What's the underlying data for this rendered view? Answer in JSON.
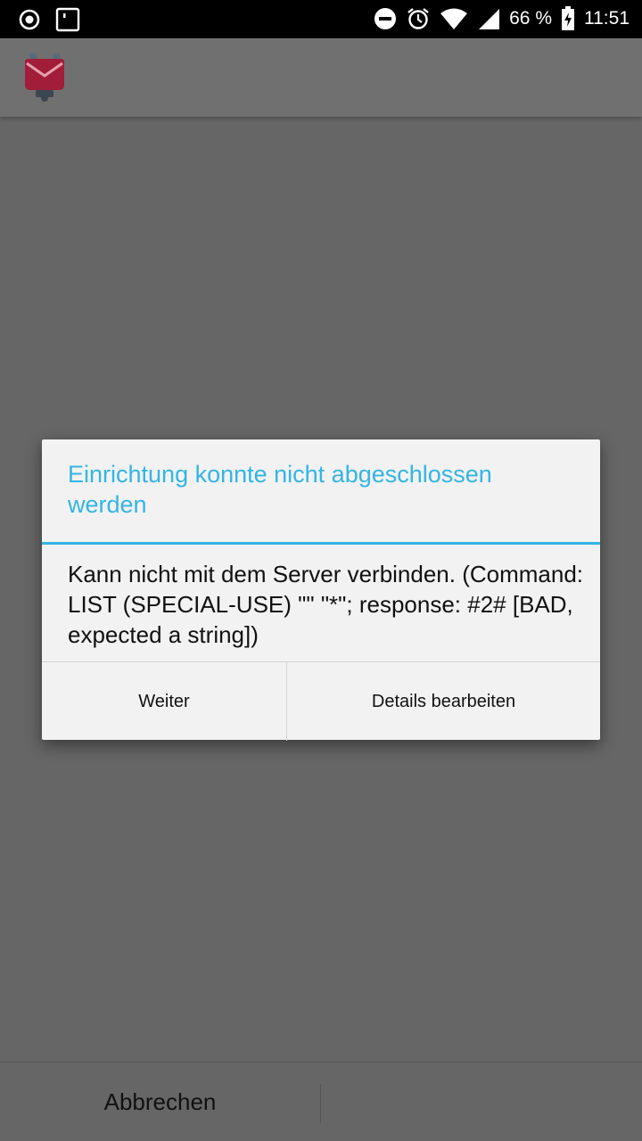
{
  "status_bar": {
    "battery_percent": "66 %",
    "time": "11:51",
    "icons": [
      "record-icon",
      "screenshot-icon",
      "do-not-disturb-icon",
      "alarm-icon",
      "wifi-icon",
      "signal-icon",
      "battery-charging-icon"
    ]
  },
  "app": {
    "logo_icon": "k9-mail-logo"
  },
  "dialog": {
    "title": "Einrichtung konnte nicht abgeschlossen werden",
    "message": "Kann nicht mit dem Server verbinden. (Command: LIST (SPECIAL-USE) \"\" \"*\"; response: #2# [BAD, expected a string])",
    "continue_label": "Weiter",
    "edit_label": "Details bearbeiten",
    "accent_color": "#33b5e5"
  },
  "bottom": {
    "cancel_label": "Abbrechen"
  }
}
